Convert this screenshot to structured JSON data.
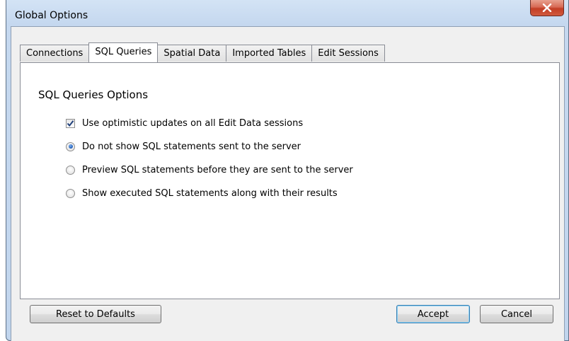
{
  "window": {
    "title": "Global Options",
    "close_icon": "close-icon"
  },
  "tabs": [
    {
      "label": "Connections",
      "active": false
    },
    {
      "label": "SQL Queries",
      "active": true
    },
    {
      "label": "Spatial Data",
      "active": false
    },
    {
      "label": "Imported Tables",
      "active": false
    },
    {
      "label": "Edit Sessions",
      "active": false
    }
  ],
  "panel": {
    "section_title": "SQL Queries Options",
    "checkbox_option": {
      "label": "Use optimistic updates on all Edit Data sessions",
      "checked": true
    },
    "radio_options": [
      {
        "label": "Do not show SQL statements sent to the server",
        "selected": true
      },
      {
        "label": "Preview SQL statements before they are sent to the server",
        "selected": false
      },
      {
        "label": "Show executed SQL statements along with their results",
        "selected": false
      }
    ]
  },
  "buttons": {
    "reset": "Reset to Defaults",
    "accept": "Accept",
    "cancel": "Cancel"
  },
  "colors": {
    "close_button": "#c33e25",
    "check_mark": "#1f3f7a",
    "radio_dot": "#1e5ab6",
    "default_button_border": "#3c7fb1"
  }
}
